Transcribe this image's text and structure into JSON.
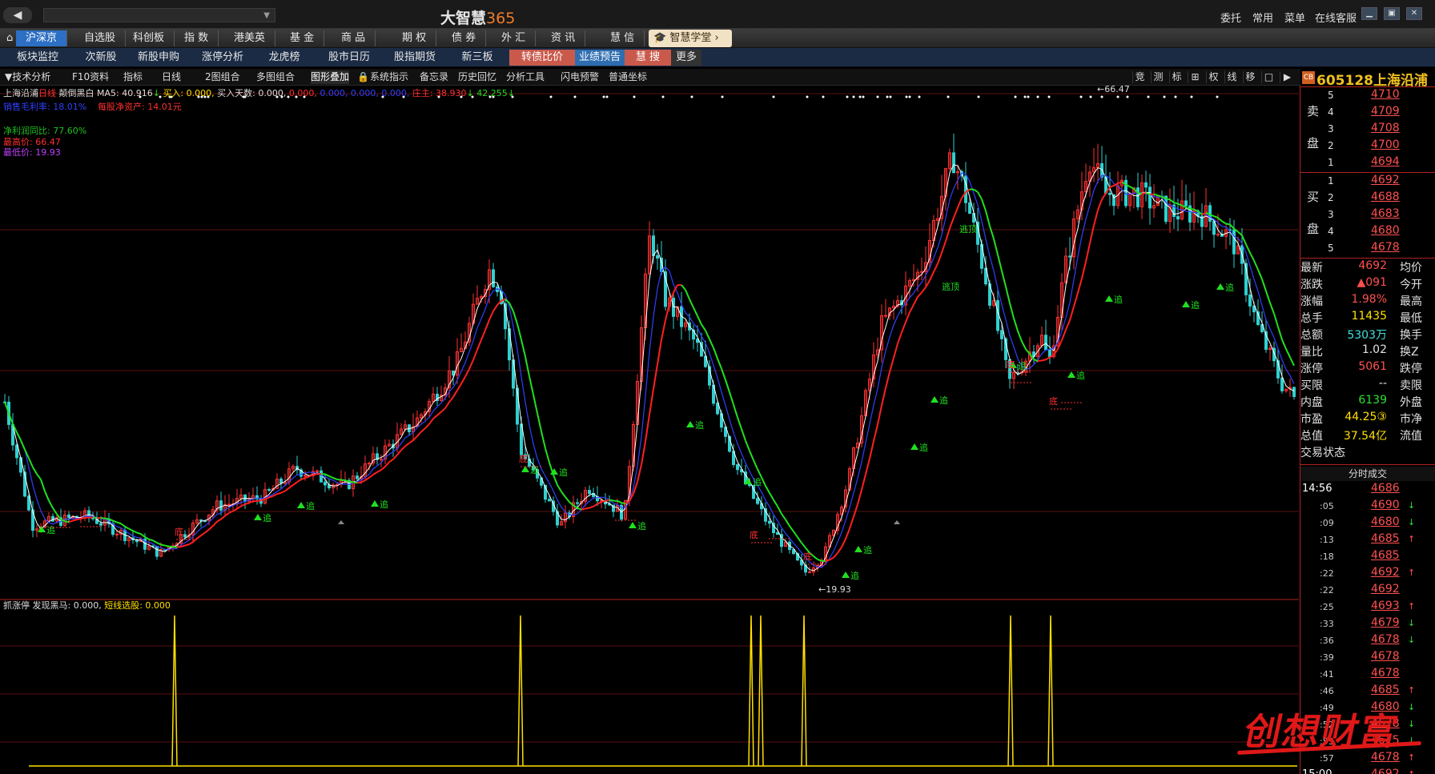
{
  "titlebar": {
    "back_icon": "◀",
    "app_name": "大智慧",
    "app_num": "365",
    "right_links": [
      "委托",
      "常用",
      "菜单",
      "在线客服"
    ]
  },
  "menubar": {
    "items": [
      "沪深京",
      "自选股",
      "科创板",
      "指 数",
      "港美英",
      "基 金",
      "商 品",
      "期 权",
      "债 券",
      "外 汇",
      "资 讯",
      "慧 信"
    ],
    "school_btn": "智慧学堂"
  },
  "subbar": {
    "items": [
      "板块监控",
      "次新股",
      "新股申购",
      "涨停分析",
      "龙虎榜",
      "股市日历",
      "股指期货",
      "新三板",
      "转债比价",
      "业绩预告",
      "慧 搜",
      "更多"
    ]
  },
  "toolbar": {
    "items": [
      "技术分析",
      "F10资料",
      "指标",
      "日线",
      "2图组合",
      "多图组合",
      "图形叠加",
      "系统指示",
      "备忘录",
      "历史回忆",
      "分析工具",
      "闪电预警",
      "普通坐标"
    ],
    "right_icons": [
      "竞",
      "测",
      "标",
      "⊞",
      "权",
      "线",
      "移",
      "□",
      "▶"
    ]
  },
  "chart": {
    "header": {
      "stock": "上海沿浦",
      "period": "日线",
      "indicator": "颠倒黑白",
      "ma5": "MA5: 40.916",
      "buy": "买入: 0.000,",
      "buy_days": "买入天数: 0.000,",
      "v1": "0.000,",
      "v2": "0.000,",
      "v3": "0.000,",
      "v4": "0.000,",
      "zhuwang": "庄主: 38.930",
      "v5": "42.255"
    },
    "info": {
      "gross_margin": "销售毛利率: 18.01%",
      "bvps": "每股净资产: 14.01元",
      "net_profit_yoy": "净利润同比: 77.60%",
      "high": "最高价: 66.47",
      "low": "最低价: 19.93"
    },
    "high_mark": "66.47",
    "low_mark": "19.93",
    "signal_buy": "追",
    "signal_bottom": "底",
    "signal_top": "逃顶"
  },
  "lower": {
    "label": "抓涨停",
    "find": "发现黑马: 0.000,",
    "short": "短线选股: 0.000"
  },
  "quote": {
    "logo": "CB",
    "code": "605128",
    "name": "上海沿浦",
    "sell_label": [
      "卖",
      "盘"
    ],
    "buy_label": [
      "买",
      "盘"
    ],
    "sell": [
      {
        "lvl": "5",
        "price": "4710"
      },
      {
        "lvl": "4",
        "price": "4709"
      },
      {
        "lvl": "3",
        "price": "4708"
      },
      {
        "lvl": "2",
        "price": "4700"
      },
      {
        "lvl": "1",
        "price": "4694"
      }
    ],
    "buy": [
      {
        "lvl": "1",
        "price": "4692"
      },
      {
        "lvl": "2",
        "price": "4688"
      },
      {
        "lvl": "3",
        "price": "4683"
      },
      {
        "lvl": "4",
        "price": "4680"
      },
      {
        "lvl": "5",
        "price": "4678"
      }
    ],
    "stats": [
      {
        "k": "最新",
        "v": "4692",
        "c": "red",
        "k2": "均价"
      },
      {
        "k": "涨跌",
        "v": "▲091",
        "c": "red",
        "k2": "今开"
      },
      {
        "k": "涨幅",
        "v": "1.98%",
        "c": "red",
        "k2": "最高"
      },
      {
        "k": "总手",
        "v": "11435",
        "c": "yel",
        "k2": "最低"
      },
      {
        "k": "总额",
        "v": "5303万",
        "c": "cyn",
        "k2": "换手"
      },
      {
        "k": "量比",
        "v": "1.02",
        "c": "wht",
        "k2": "换Z"
      },
      {
        "k": "涨停",
        "v": "5061",
        "c": "red",
        "k2": "跌停"
      },
      {
        "k": "买限",
        "v": "--",
        "c": "wht",
        "k2": "卖限"
      },
      {
        "k": "内盘",
        "v": "6139",
        "c": "grn",
        "k2": "外盘"
      },
      {
        "k": "市盈",
        "v": "44.25③",
        "c": "yel",
        "k2": "市净"
      },
      {
        "k": "总值",
        "v": "37.54亿",
        "c": "yel",
        "k2": "流值"
      },
      {
        "k": "交易状态",
        "v": "",
        "c": "wht",
        "k2": ""
      }
    ],
    "ticks_title": "分时成交",
    "ticks": [
      {
        "t": "14:56",
        "p": "4686",
        "a": ""
      },
      {
        "t": ":05",
        "p": "4690",
        "a": "↓"
      },
      {
        "t": ":09",
        "p": "4680",
        "a": "↓"
      },
      {
        "t": ":13",
        "p": "4685",
        "a": "↑"
      },
      {
        "t": ":18",
        "p": "4685",
        "a": ""
      },
      {
        "t": ":22",
        "p": "4692",
        "a": "↑"
      },
      {
        "t": ":22",
        "p": "4692",
        "a": ""
      },
      {
        "t": ":25",
        "p": "4693",
        "a": "↑"
      },
      {
        "t": ":33",
        "p": "4679",
        "a": "↓"
      },
      {
        "t": ":36",
        "p": "4678",
        "a": "↓"
      },
      {
        "t": ":39",
        "p": "4678",
        "a": ""
      },
      {
        "t": ":41",
        "p": "4678",
        "a": ""
      },
      {
        "t": ":46",
        "p": "4685",
        "a": "↑"
      },
      {
        "t": ":49",
        "p": "4680",
        "a": "↓"
      },
      {
        "t": ":52",
        "p": "4678",
        "a": "↓"
      },
      {
        "t": ":55",
        "p": "4675",
        "a": "↓"
      },
      {
        "t": ":57",
        "p": "4678",
        "a": "↑"
      },
      {
        "t": "15:00",
        "p": "4692",
        "a": "↑"
      }
    ]
  },
  "watermark": "创想财富",
  "colors": {
    "red": "#ff3030",
    "green": "#20e020",
    "blue": "#3040ff",
    "yellow": "#ffe000",
    "accent": "#2c6fc4"
  }
}
